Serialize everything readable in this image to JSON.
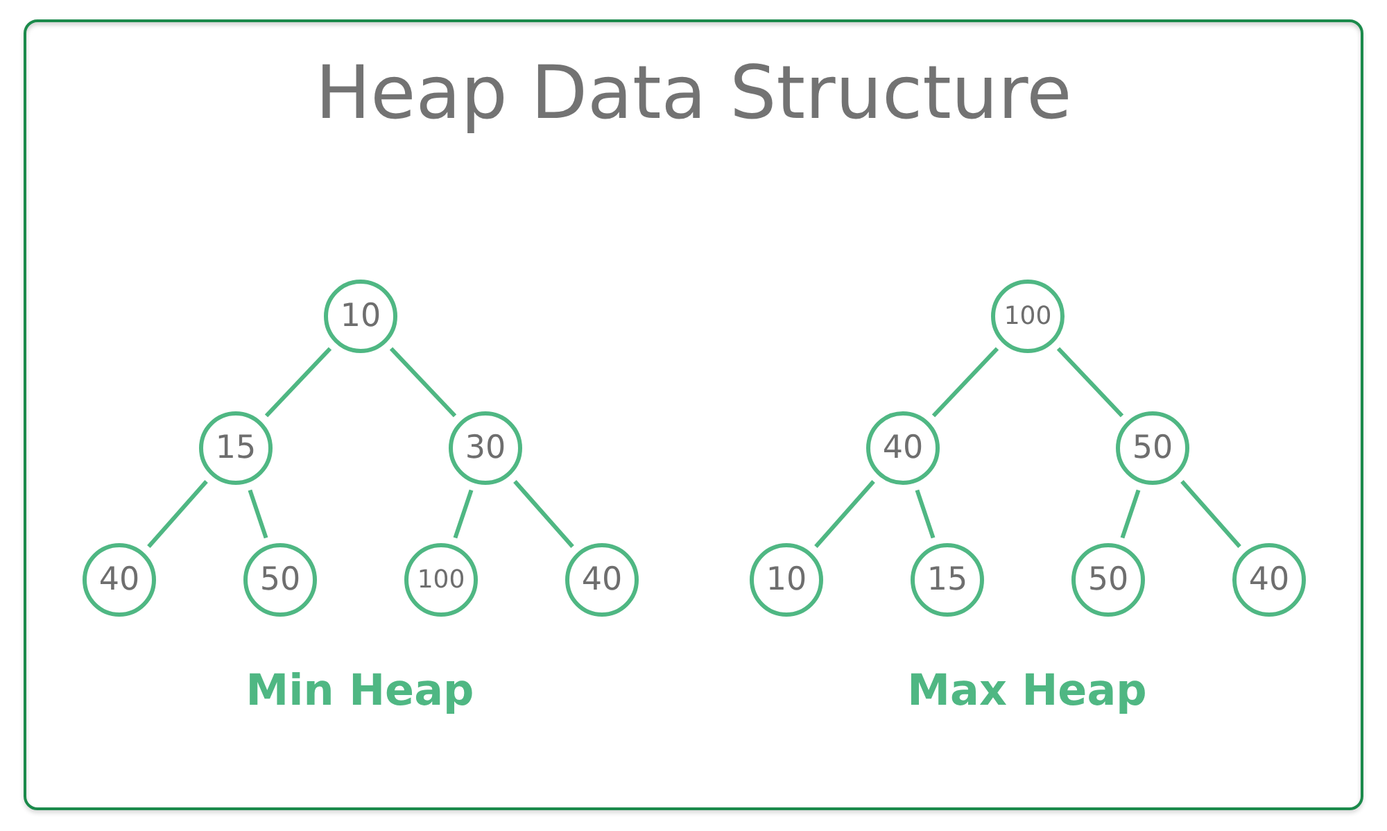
{
  "title": "Heap Data Structure",
  "heaps": [
    {
      "label": "Min Heap",
      "tree": {
        "value": "10",
        "children": [
          {
            "value": "15",
            "children": [
              {
                "value": "40"
              },
              {
                "value": "50"
              }
            ]
          },
          {
            "value": "30",
            "children": [
              {
                "value": "100"
              },
              {
                "value": "40"
              }
            ]
          }
        ]
      }
    },
    {
      "label": "Max Heap",
      "tree": {
        "value": "100",
        "children": [
          {
            "value": "40",
            "children": [
              {
                "value": "10"
              },
              {
                "value": "15"
              }
            ]
          },
          {
            "value": "50",
            "children": [
              {
                "value": "50"
              },
              {
                "value": "40"
              }
            ]
          }
        ]
      }
    }
  ]
}
